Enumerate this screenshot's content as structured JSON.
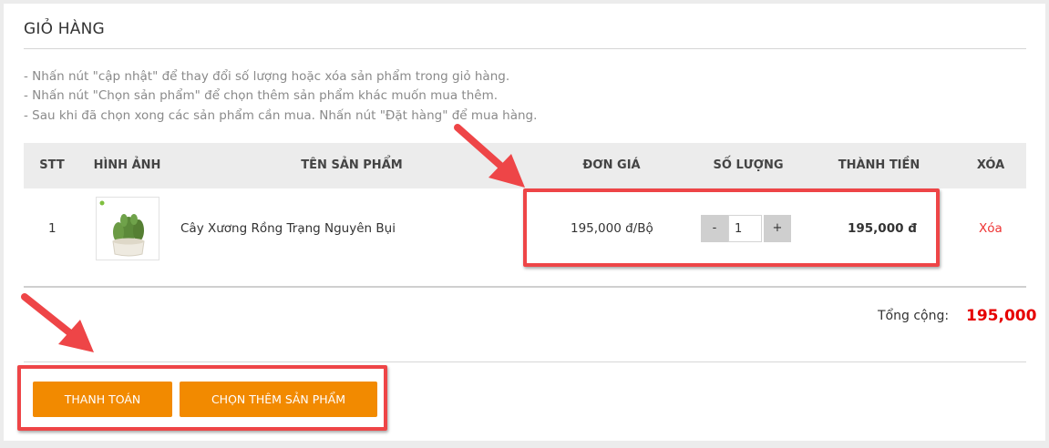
{
  "cart": {
    "title": "GIỎ HÀNG",
    "instructions": [
      "- Nhấn nút \"cập nhật\" để thay đổi số lượng hoặc xóa sản phẩm trong giỏ hàng.",
      "- Nhấn nút \"Chọn sản phẩm\" để chọn thêm sản phẩm khác muốn mua thêm.",
      "- Sau khi đã chọn xong các sản phẩm cần mua. Nhấn nút \"Đặt hàng\" để mua hàng."
    ],
    "columns": {
      "stt": "STT",
      "image": "HÌNH ẢNH",
      "name": "TÊN SẢN PHẨM",
      "price": "ĐƠN GIÁ",
      "quantity": "SỐ LƯỢNG",
      "total": "THÀNH TIỀN",
      "remove": "XÓA"
    },
    "items": [
      {
        "stt": "1",
        "name": "Cây Xương Rồng Trạng Nguyên Bụi",
        "price": "195,000 đ/Bộ",
        "quantity": "1",
        "total": "195,000 đ",
        "remove_label": "Xóa",
        "minus_label": "-",
        "plus_label": "+"
      }
    ],
    "summary": {
      "label": "Tổng cộng:",
      "value": "195,000"
    },
    "buttons": {
      "checkout": "THANH TOÁN",
      "continue": "CHỌN THÊM SẢN PHẨM"
    }
  },
  "colors": {
    "accent": "#f28a00",
    "price_red": "#e60000",
    "annotation": "#ee4547"
  }
}
